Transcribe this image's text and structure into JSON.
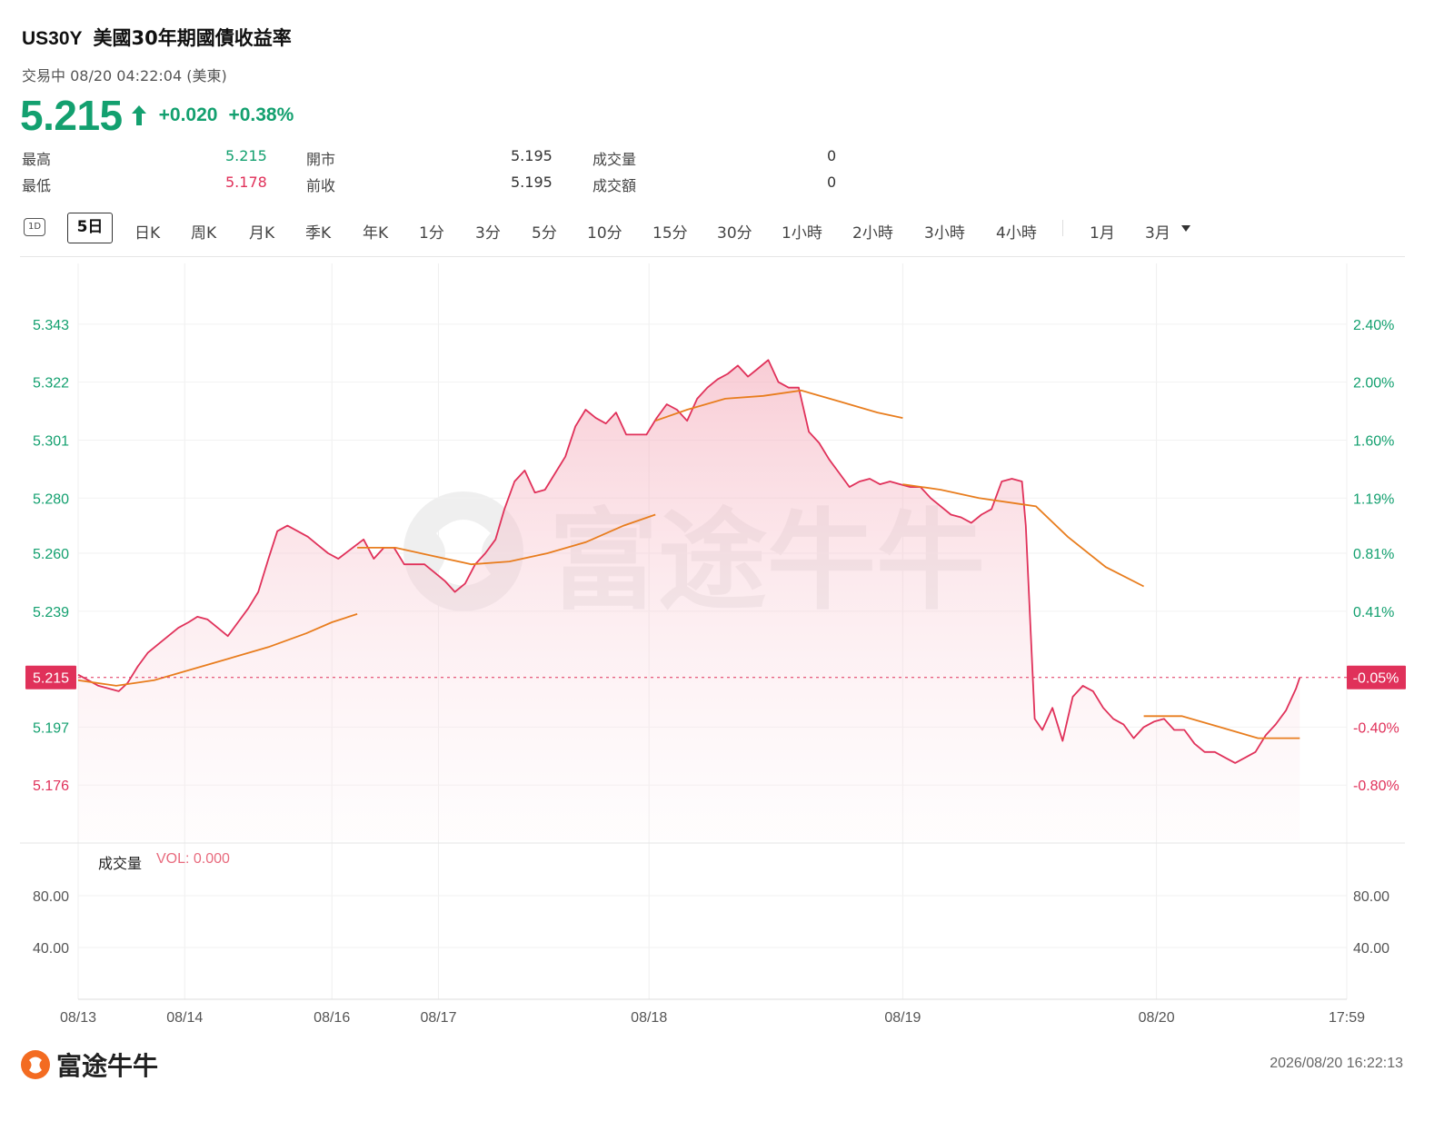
{
  "header": {
    "symbol": "US30Y",
    "name": "美國30年期國債收益率",
    "status": "交易中 08/20 04:22:04 (美東)",
    "price": "5.215",
    "change": "+0.020",
    "change_pct": "+0.38%"
  },
  "stats": {
    "high_label": "最高",
    "high": "5.215",
    "low_label": "最低",
    "low": "5.178",
    "open_label": "開市",
    "open": "5.195",
    "prev_label": "前收",
    "prev": "5.195",
    "volume_label": "成交量",
    "volume": "0",
    "turnover_label": "成交額",
    "turnover": "0"
  },
  "tabs": {
    "t1d": "1D",
    "items": [
      "5日",
      "日K",
      "周K",
      "月K",
      "季K",
      "年K",
      "1分",
      "3分",
      "5分",
      "10分",
      "15分",
      "30分",
      "1小時",
      "2小時",
      "3小時",
      "4小時",
      "1月",
      "3月"
    ]
  },
  "volume_panel": {
    "label": "成交量",
    "value": "VOL: 0.000",
    "ticks_left": [
      "80.00",
      "40.00"
    ],
    "ticks_right": [
      "80.00",
      "40.00"
    ]
  },
  "footer": {
    "brand": "富途牛牛",
    "timestamp": "2026/08/20 16:22:13",
    "watermark": "富途牛牛"
  },
  "colors": {
    "up": "#13a06f",
    "down": "#e0315a",
    "price_line": "#e0315a",
    "ma_line": "#e87d1e"
  },
  "chart_data": {
    "type": "line",
    "prev_close": 5.195,
    "current": 5.215,
    "current_pct_label": "-0.05%",
    "y_ticks_left": [
      "5.343",
      "5.322",
      "5.301",
      "5.280",
      "5.260",
      "5.239",
      "5.197",
      "5.176"
    ],
    "y_ticks_right": [
      "2.40%",
      "2.00%",
      "1.60%",
      "1.19%",
      "0.81%",
      "0.41%",
      "-0.40%",
      "-0.80%"
    ],
    "x_ticks": [
      "08/13",
      "08/14",
      "08/16",
      "08/17",
      "08/18",
      "08/19",
      "08/20",
      "17:59"
    ],
    "ylim": [
      5.156,
      5.365
    ],
    "price_series": [
      [
        0.0,
        5.216
      ],
      [
        0.8,
        5.214
      ],
      [
        1.6,
        5.212
      ],
      [
        2.4,
        5.211
      ],
      [
        3.2,
        5.21
      ],
      [
        3.9,
        5.213
      ],
      [
        4.7,
        5.219
      ],
      [
        5.5,
        5.224
      ],
      [
        6.3,
        5.227
      ],
      [
        7.1,
        5.23
      ],
      [
        7.9,
        5.233
      ],
      [
        8.7,
        5.235
      ],
      [
        9.4,
        5.237
      ],
      [
        10.2,
        5.236
      ],
      [
        11.0,
        5.233
      ],
      [
        11.8,
        5.23
      ],
      [
        12.6,
        5.235
      ],
      [
        13.4,
        5.24
      ],
      [
        14.2,
        5.246
      ],
      [
        15.0,
        5.258
      ],
      [
        15.7,
        5.268
      ],
      [
        16.5,
        5.27
      ],
      [
        17.3,
        5.268
      ],
      [
        18.1,
        5.266
      ],
      [
        18.9,
        5.263
      ],
      [
        19.7,
        5.26
      ],
      [
        20.5,
        5.258
      ],
      [
        22.5,
        5.265
      ],
      [
        23.3,
        5.258
      ],
      [
        24.1,
        5.262
      ],
      [
        24.9,
        5.262
      ],
      [
        25.7,
        5.256
      ],
      [
        26.5,
        5.256
      ],
      [
        27.3,
        5.256
      ],
      [
        28.1,
        5.253
      ],
      [
        28.9,
        5.25
      ],
      [
        29.7,
        5.246
      ],
      [
        30.5,
        5.249
      ],
      [
        31.3,
        5.256
      ],
      [
        32.1,
        5.26
      ],
      [
        32.9,
        5.265
      ],
      [
        33.6,
        5.276
      ],
      [
        34.4,
        5.286
      ],
      [
        35.2,
        5.29
      ],
      [
        36.0,
        5.282
      ],
      [
        36.8,
        5.283
      ],
      [
        37.6,
        5.289
      ],
      [
        38.4,
        5.295
      ],
      [
        39.2,
        5.306
      ],
      [
        40.0,
        5.312
      ],
      [
        40.8,
        5.309
      ],
      [
        41.6,
        5.307
      ],
      [
        42.4,
        5.311
      ],
      [
        43.2,
        5.303
      ],
      [
        44.0,
        5.303
      ],
      [
        44.8,
        5.303
      ],
      [
        45.6,
        5.309
      ],
      [
        46.4,
        5.314
      ],
      [
        47.2,
        5.312
      ],
      [
        48.0,
        5.308
      ],
      [
        48.8,
        5.316
      ],
      [
        49.6,
        5.32
      ],
      [
        50.4,
        5.323
      ],
      [
        51.2,
        5.325
      ],
      [
        52.0,
        5.328
      ],
      [
        52.8,
        5.324
      ],
      [
        53.6,
        5.327
      ],
      [
        54.4,
        5.33
      ],
      [
        55.2,
        5.322
      ],
      [
        56.0,
        5.32
      ],
      [
        56.8,
        5.32
      ],
      [
        57.6,
        5.304
      ],
      [
        58.4,
        5.3
      ],
      [
        59.2,
        5.294
      ],
      [
        60.0,
        5.289
      ],
      [
        60.8,
        5.284
      ],
      [
        61.6,
        5.286
      ],
      [
        62.4,
        5.287
      ],
      [
        63.2,
        5.285
      ],
      [
        64.0,
        5.286
      ],
      [
        64.8,
        5.285
      ],
      [
        65.6,
        5.284
      ],
      [
        66.4,
        5.284
      ],
      [
        67.2,
        5.28
      ],
      [
        68.0,
        5.277
      ],
      [
        68.8,
        5.274
      ],
      [
        69.6,
        5.273
      ],
      [
        70.4,
        5.271
      ],
      [
        71.2,
        5.274
      ],
      [
        72.0,
        5.276
      ],
      [
        72.8,
        5.286
      ],
      [
        73.6,
        5.287
      ],
      [
        74.4,
        5.286
      ],
      [
        74.7,
        5.27
      ],
      [
        75.2,
        5.22
      ],
      [
        75.4,
        5.2
      ],
      [
        76.0,
        5.196
      ],
      [
        76.8,
        5.204
      ],
      [
        77.6,
        5.192
      ],
      [
        78.4,
        5.208
      ],
      [
        79.2,
        5.212
      ],
      [
        80.0,
        5.21
      ],
      [
        80.8,
        5.204
      ],
      [
        81.6,
        5.2
      ],
      [
        82.4,
        5.198
      ],
      [
        83.2,
        5.193
      ],
      [
        84.0,
        5.197
      ],
      [
        84.8,
        5.199
      ],
      [
        85.6,
        5.2
      ],
      [
        86.4,
        5.196
      ],
      [
        87.2,
        5.196
      ],
      [
        88.0,
        5.191
      ],
      [
        88.8,
        5.188
      ],
      [
        89.6,
        5.188
      ],
      [
        90.4,
        5.186
      ],
      [
        91.2,
        5.184
      ],
      [
        92.0,
        5.186
      ],
      [
        92.8,
        5.188
      ],
      [
        93.6,
        5.194
      ],
      [
        94.4,
        5.198
      ],
      [
        95.2,
        5.203
      ],
      [
        96.0,
        5.211
      ],
      [
        96.3,
        5.215
      ]
    ],
    "ma_segments": [
      [
        [
          0.0,
          5.214
        ],
        [
          3.0,
          5.212
        ],
        [
          6.0,
          5.214
        ],
        [
          9.0,
          5.218
        ],
        [
          12.0,
          5.222
        ],
        [
          15.0,
          5.226
        ],
        [
          18.0,
          5.231
        ],
        [
          20.0,
          5.235
        ],
        [
          22.0,
          5.238
        ]
      ],
      [
        [
          22.0,
          5.262
        ],
        [
          25.0,
          5.262
        ],
        [
          28.0,
          5.259
        ],
        [
          31.0,
          5.256
        ],
        [
          34.0,
          5.257
        ],
        [
          37.0,
          5.26
        ],
        [
          40.0,
          5.264
        ],
        [
          43.0,
          5.27
        ],
        [
          45.5,
          5.274
        ]
      ],
      [
        [
          45.5,
          5.308
        ],
        [
          48.0,
          5.312
        ],
        [
          51.0,
          5.316
        ],
        [
          54.0,
          5.317
        ],
        [
          57.0,
          5.319
        ],
        [
          60.0,
          5.315
        ],
        [
          63.0,
          5.311
        ],
        [
          65.0,
          5.309
        ]
      ],
      [
        [
          65.0,
          5.285
        ],
        [
          68.0,
          5.283
        ],
        [
          71.0,
          5.28
        ],
        [
          74.0,
          5.278
        ],
        [
          75.5,
          5.277
        ],
        [
          78.0,
          5.266
        ],
        [
          81.0,
          5.255
        ],
        [
          84.0,
          5.248
        ]
      ],
      [
        [
          84.0,
          5.201
        ],
        [
          87.0,
          5.201
        ],
        [
          90.0,
          5.197
        ],
        [
          93.0,
          5.193
        ],
        [
          96.3,
          5.193
        ]
      ]
    ],
    "ylabel": "",
    "xlabel": ""
  }
}
